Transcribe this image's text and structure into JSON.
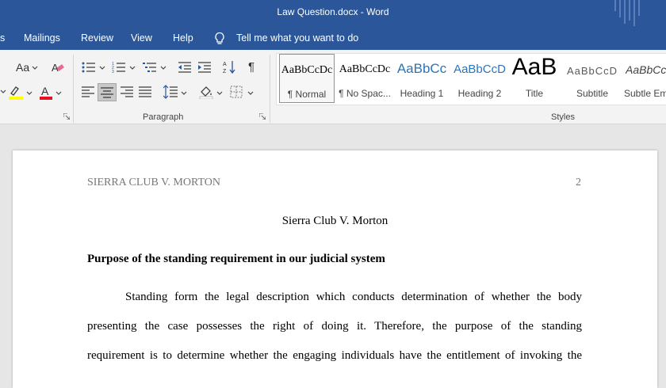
{
  "window": {
    "title": "Law Question.docx  -  Word"
  },
  "menu": {
    "items": [
      "s",
      "Mailings",
      "Review",
      "View",
      "Help"
    ],
    "tell_me": "Tell me what you want to do"
  },
  "ribbon": {
    "paragraph_label": "Paragraph",
    "styles_label": "Styles",
    "font_size_glyph": "Aa",
    "show_marks_glyph": "¶",
    "styles": [
      {
        "sample": "AaBbCcDc",
        "label": "¶ Normal"
      },
      {
        "sample": "AaBbCcDc",
        "label": "¶ No Spac..."
      },
      {
        "sample": "AaBbCc",
        "label": "Heading 1"
      },
      {
        "sample": "AaBbCcD",
        "label": "Heading 2"
      },
      {
        "sample": "AaB",
        "label": "Title"
      },
      {
        "sample": "AaBbCcD",
        "label": "Subtitle"
      },
      {
        "sample": "AaBbCcDc",
        "label": "Subtle Em"
      }
    ],
    "colors": {
      "highlight": "#ffff00",
      "font_color": "#e81123",
      "accent": "#2b579a"
    }
  },
  "document": {
    "header_left": "SIERRA CLUB V. MORTON",
    "page_number": "2",
    "title": "Sierra Club V. Morton",
    "heading": "Purpose of the standing requirement in our judicial system",
    "paragraph_lines": [
      "Standing form the legal description which conducts determination of whether the body",
      "presenting the case possesses the right of doing it. Therefore, the purpose of the standing",
      "requirement is to determine whether the engaging individuals have the entitlement of invoking the"
    ]
  }
}
